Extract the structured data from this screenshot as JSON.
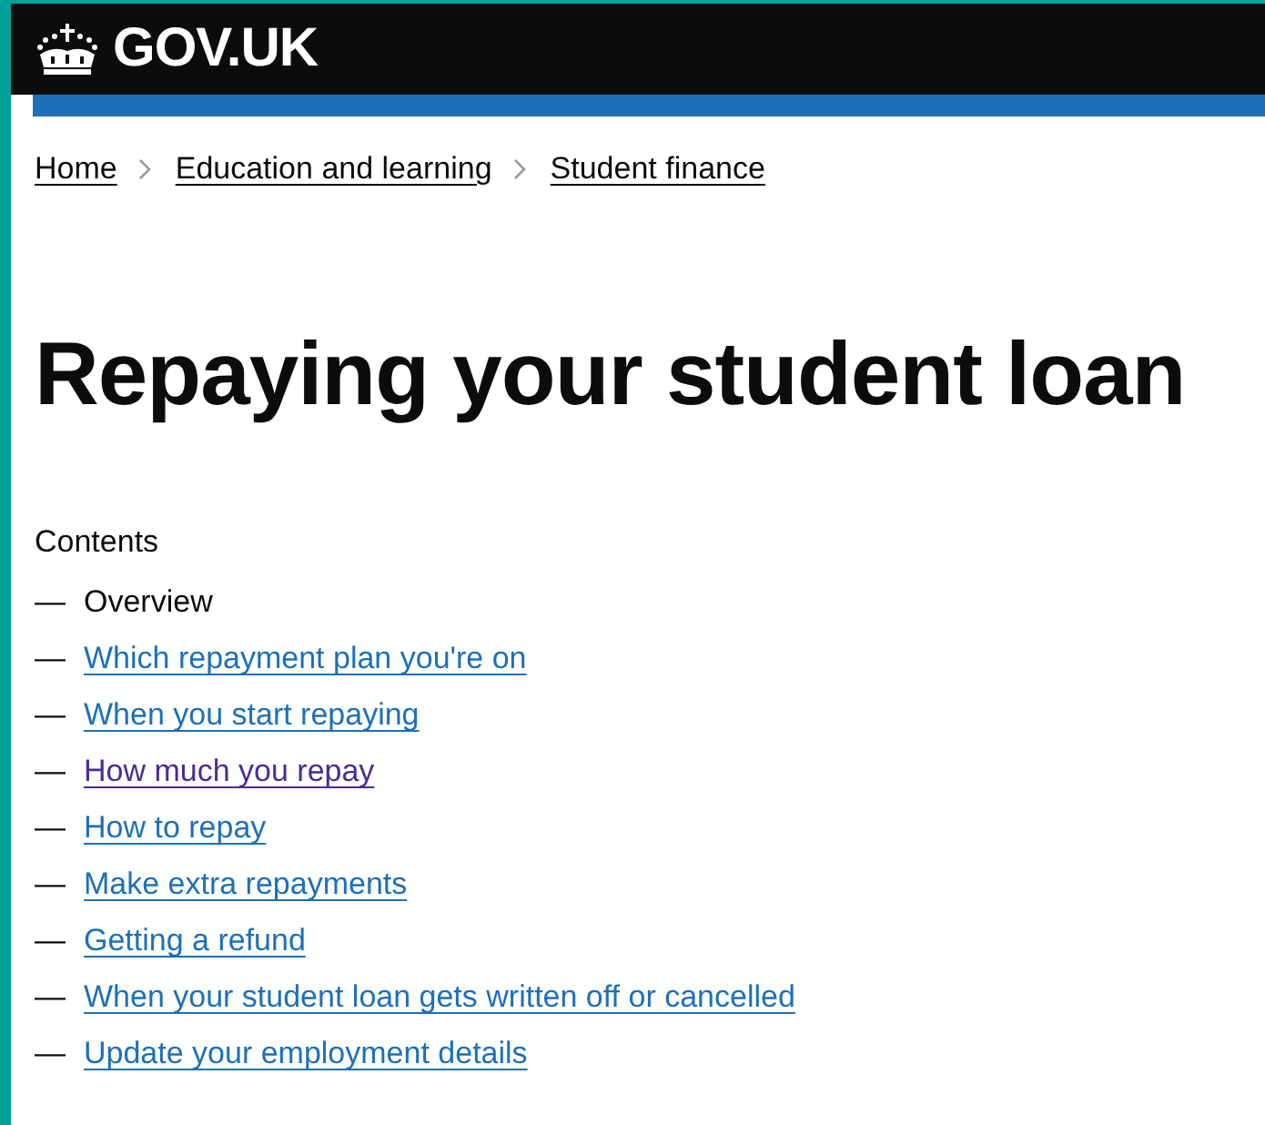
{
  "header": {
    "logo_text": "GOV.UK"
  },
  "breadcrumbs": [
    {
      "label": "Home"
    },
    {
      "label": "Education and learning"
    },
    {
      "label": "Student finance"
    }
  ],
  "title": "Repaying your student loan",
  "contents": {
    "heading": "Contents",
    "items": [
      {
        "dash": "—",
        "label": "Overview",
        "current": true
      },
      {
        "dash": "—",
        "label": "Which repayment plan you're on",
        "current": false,
        "visited": false
      },
      {
        "dash": "—",
        "label": "When you start repaying",
        "current": false,
        "visited": false
      },
      {
        "dash": "—",
        "label": "How much you repay",
        "current": false,
        "visited": true
      },
      {
        "dash": "—",
        "label": "How to repay",
        "current": false,
        "visited": false
      },
      {
        "dash": "—",
        "label": "Make extra repayments",
        "current": false,
        "visited": false
      },
      {
        "dash": "—",
        "label": "Getting a refund",
        "current": false,
        "visited": false
      },
      {
        "dash": "—",
        "label": "When your student loan gets written off or cancelled",
        "current": false,
        "visited": false
      },
      {
        "dash": "—",
        "label": "Update your employment details",
        "current": false,
        "visited": false
      }
    ]
  }
}
